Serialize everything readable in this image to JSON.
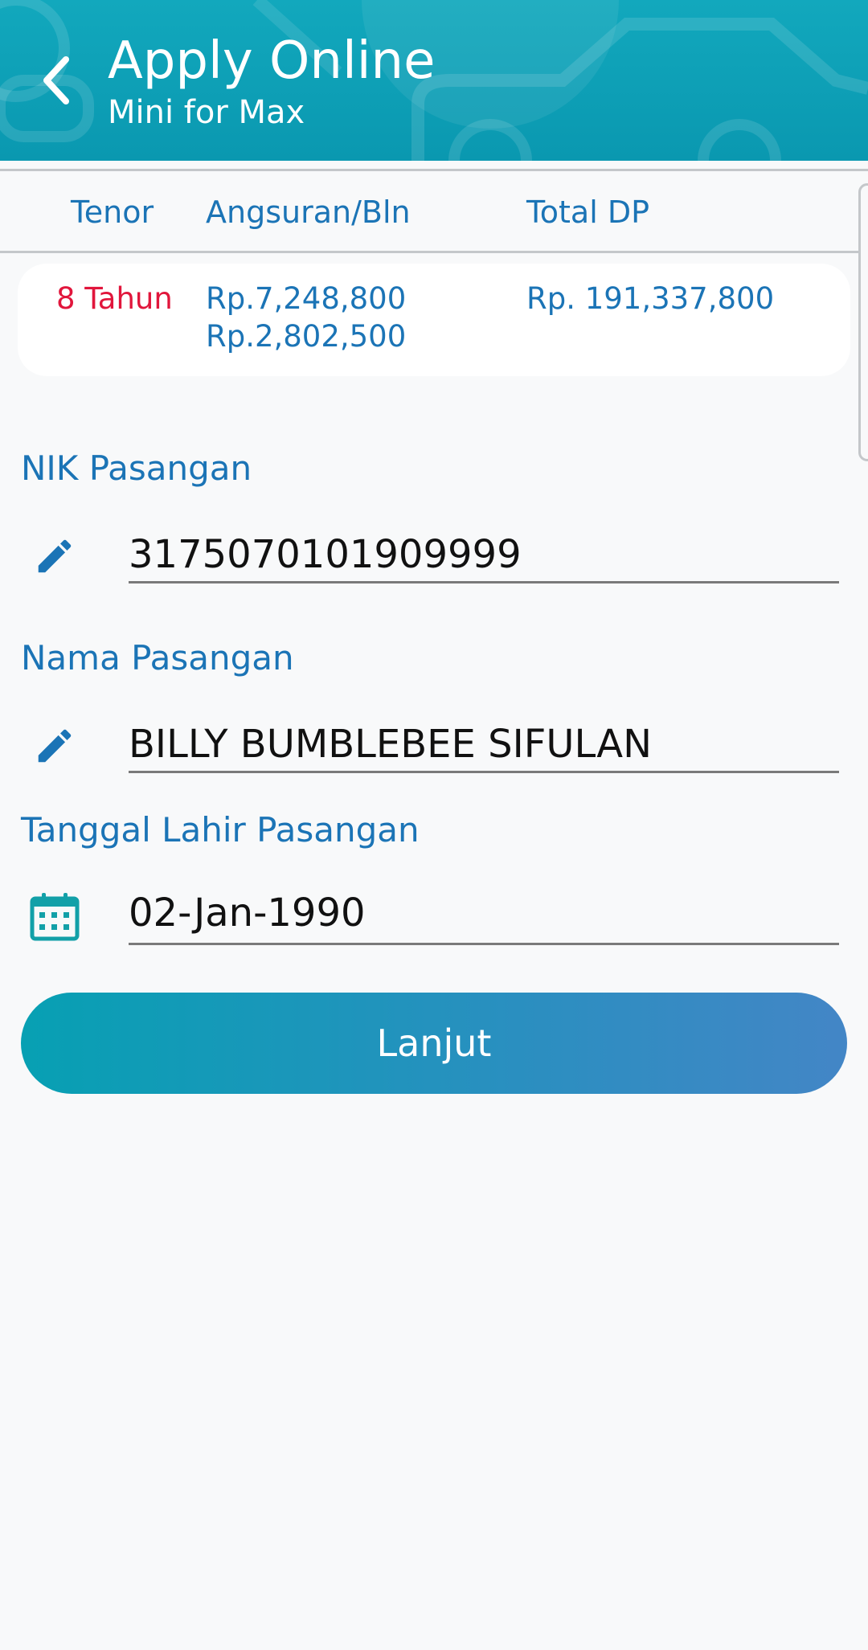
{
  "header": {
    "title": "Apply Online",
    "subtitle": "Mini for Max",
    "background_color": "#0a98b0",
    "back_icon": "chevron-left-icon"
  },
  "summary": {
    "columns": [
      "Tenor",
      "Angsuran/Bln",
      "Total DP"
    ],
    "row": {
      "tenor": "8 Tahun",
      "angsuran_1": "Rp.7,248,800",
      "angsuran_2": "Rp.2,802,500",
      "total_dp": "Rp. 191,337,800"
    },
    "tenor_color": "#e1163c",
    "value_color": "#1b74b6"
  },
  "form": {
    "nik": {
      "label": "NIK Pasangan",
      "value": "3175070101909999",
      "icon": "pencil-icon"
    },
    "nama": {
      "label": "Nama Pasangan",
      "value": "BILLY BUMBLEBEE SIFULAN",
      "icon": "pencil-icon"
    },
    "tanggal": {
      "label": "Tanggal Lahir Pasangan",
      "value": "02-Jan-1990",
      "icon": "calendar-icon"
    }
  },
  "actions": {
    "next_label": "Lanjut"
  }
}
